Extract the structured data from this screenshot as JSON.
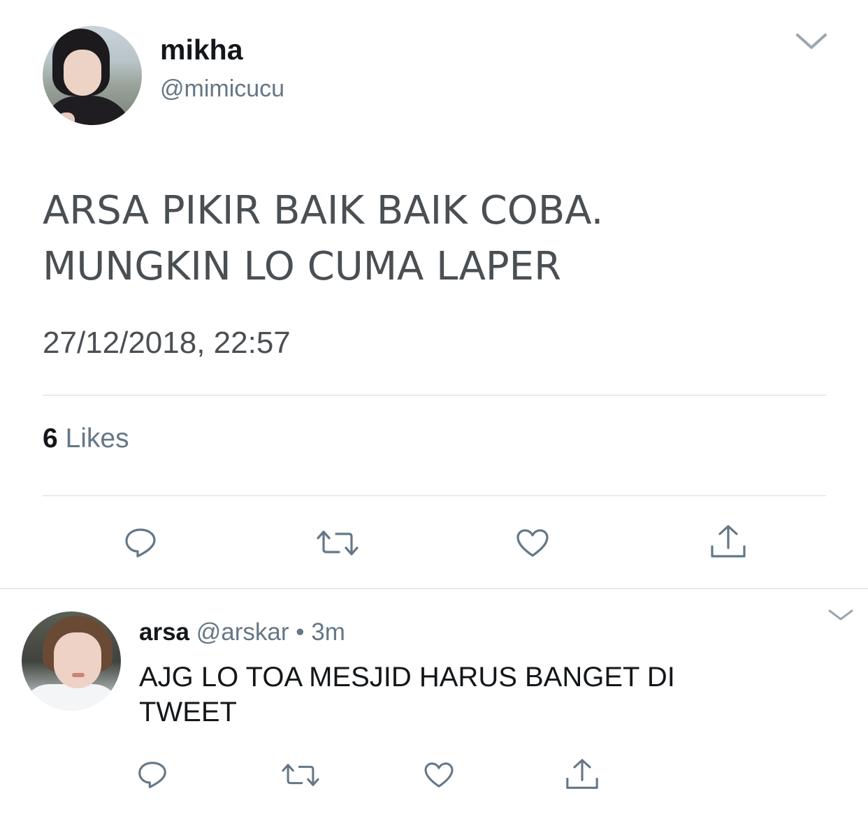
{
  "main_tweet": {
    "author_name": "mikha",
    "author_handle": "@mimicucu",
    "text_lines": [
      "ARSA PIKIR BAIK BAIK COBA.",
      "MUNGKIN LO CUMA LAPER"
    ],
    "timestamp": "27/12/2018, 22:57",
    "likes_count": "6",
    "likes_label": "Likes",
    "actions": [
      "reply-icon",
      "retweet-icon",
      "like-icon",
      "share-icon"
    ]
  },
  "reply": {
    "author_name": "arsa",
    "author_handle": "@arskar",
    "separator": "•",
    "time": "3m",
    "text_lines": [
      "AJG LO TOA MESJID HARUS BANGET DI",
      "TWEET"
    ],
    "actions": [
      "reply-icon",
      "retweet-icon",
      "like-icon",
      "share-icon"
    ]
  },
  "colors": {
    "text_primary": "#14171a",
    "text_secondary": "#657786",
    "divider": "#d5dbe0",
    "icon": "#657786"
  }
}
